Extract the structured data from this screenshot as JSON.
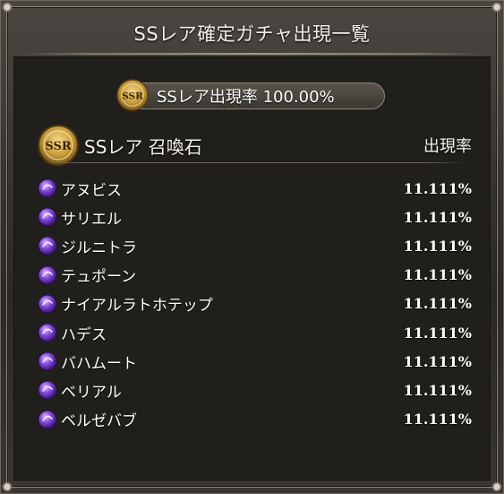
{
  "dialog": {
    "title": "SSレア確定ガチャ出現一覧",
    "badge_text": "SSR",
    "overall_rate": "SSレア出現率 100.00%"
  },
  "list": {
    "category": "SSレア 召喚石",
    "rate_header": "出現率",
    "items": [
      {
        "name": "アヌビス",
        "rate": "11.111%"
      },
      {
        "name": "サリエル",
        "rate": "11.111%"
      },
      {
        "name": "ジルニトラ",
        "rate": "11.111%"
      },
      {
        "name": "テュポーン",
        "rate": "11.111%"
      },
      {
        "name": "ナイアルラトホテップ",
        "rate": "11.111%"
      },
      {
        "name": "ハデス",
        "rate": "11.111%"
      },
      {
        "name": "バハムート",
        "rate": "11.111%"
      },
      {
        "name": "ベリアル",
        "rate": "11.111%"
      },
      {
        "name": "ベルゼバブ",
        "rate": "11.111%"
      }
    ]
  },
  "icons": {
    "badge": "ssr-badge-icon",
    "item": "purple-orb-icon"
  },
  "colors": {
    "panel_bg": "#211f1c",
    "frame": "#3a3631",
    "text": "#ffffff",
    "badge_gold": "#c89b3a",
    "orb_purple": "#7a3fd0"
  }
}
